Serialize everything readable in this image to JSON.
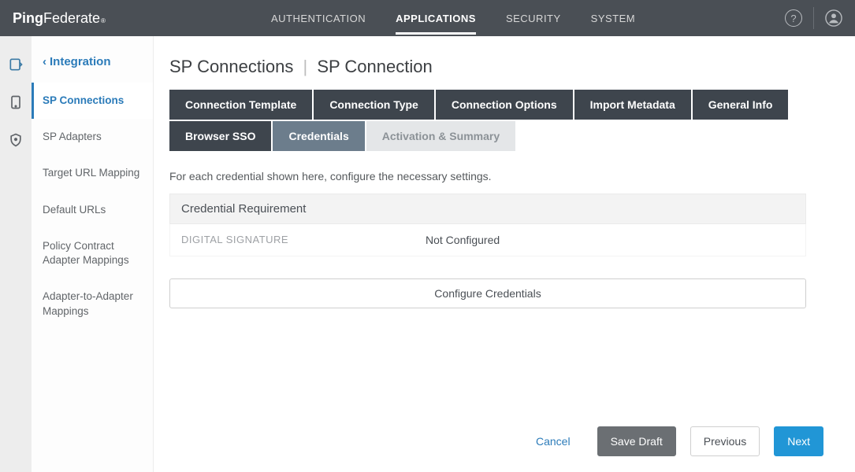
{
  "brand": {
    "part1": "Ping",
    "part2": "Federate",
    "reg": "®"
  },
  "topnav": {
    "items": [
      {
        "label": "AUTHENTICATION"
      },
      {
        "label": "APPLICATIONS",
        "active": true
      },
      {
        "label": "SECURITY"
      },
      {
        "label": "SYSTEM"
      }
    ]
  },
  "sidebar": {
    "title": "Integration",
    "items": [
      {
        "label": "SP Connections",
        "active": true
      },
      {
        "label": "SP Adapters"
      },
      {
        "label": "Target URL Mapping"
      },
      {
        "label": "Default URLs"
      },
      {
        "label": "Policy Contract Adapter Mappings"
      },
      {
        "label": "Adapter-to-Adapter Mappings"
      }
    ]
  },
  "page": {
    "title_left": "SP Connections",
    "title_right": "SP Connection"
  },
  "tabs": [
    {
      "label": "Connection Template"
    },
    {
      "label": "Connection Type"
    },
    {
      "label": "Connection Options"
    },
    {
      "label": "Import Metadata"
    },
    {
      "label": "General Info"
    },
    {
      "label": "Browser SSO"
    },
    {
      "label": "Credentials",
      "current": true
    },
    {
      "label": "Activation & Summary",
      "disabled": true
    }
  ],
  "description": "For each credential shown here, configure the necessary settings.",
  "credentials": {
    "header": "Credential Requirement",
    "rows": [
      {
        "label": "DIGITAL SIGNATURE",
        "value": "Not Configured"
      }
    ]
  },
  "buttons": {
    "configure": "Configure Credentials",
    "cancel": "Cancel",
    "save_draft": "Save Draft",
    "previous": "Previous",
    "next": "Next"
  },
  "help_icon": "?"
}
